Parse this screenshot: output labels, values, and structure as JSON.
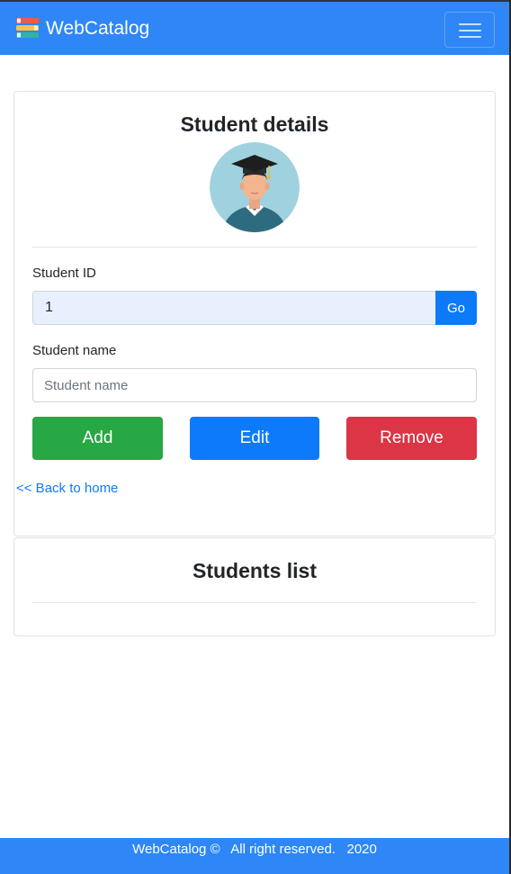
{
  "navbar": {
    "brand": "WebCatalog",
    "logo_icon": "books-icon",
    "toggler_icon": "hamburger-menu-icon"
  },
  "details": {
    "title": "Student details",
    "avatar_icon": "graduate-avatar-icon",
    "id_label": "Student ID",
    "id_value": "1",
    "go_label": "Go",
    "name_label": "Student name",
    "name_placeholder": "Student name",
    "name_value": "",
    "add_label": "Add",
    "edit_label": "Edit",
    "remove_label": "Remove",
    "back_link": "<< Back to home"
  },
  "list": {
    "title": "Students list"
  },
  "footer": {
    "text": "WebCatalog ©   All right reserved.   2020"
  },
  "colors": {
    "primary": "#2e86f7",
    "button_primary": "#0d7bf9",
    "success": "#28a745",
    "danger": "#dc3545",
    "input_autofill": "#e8f0fe"
  }
}
